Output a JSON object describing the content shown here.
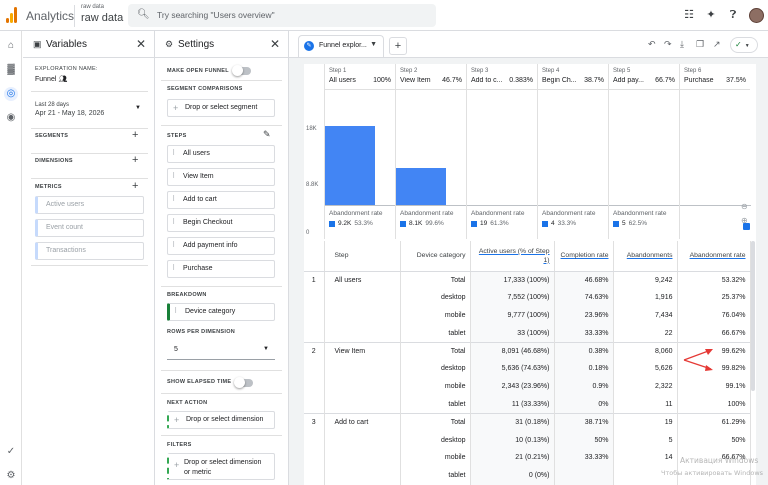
{
  "app": {
    "title": "Analytics",
    "property_small": "raw data",
    "property_big": "raw data",
    "search_placeholder": "Try searching \"Users overview\""
  },
  "variables_panel": {
    "title": "Variables",
    "exploration_name_label": "EXPLORATION NAME:",
    "exploration_name": "Funnel",
    "date_label": "Last 28 days",
    "date_range": "Apr 21 - May 18, 2026",
    "segments_label": "SEGMENTS",
    "dimensions_label": "DIMENSIONS",
    "metrics_label": "METRICS",
    "metrics": [
      "Active users",
      "Event count",
      "Transactions"
    ]
  },
  "settings_panel": {
    "title": "Settings",
    "make_open_funnel_label": "MAKE OPEN FUNNEL",
    "segment_comparisons_label": "SEGMENT COMPARISONS",
    "segment_drop": "Drop or select segment",
    "steps_label": "STEPS",
    "steps": [
      "All users",
      "View Item",
      "Add to cart",
      "Begin Checkout",
      "Add payment info",
      "Purchase"
    ],
    "breakdown_label": "BREAKDOWN",
    "breakdown_value": "Device category",
    "rows_per_dimension_label": "ROWS PER DIMENSION",
    "rows_per_dimension_value": "5",
    "show_elapsed_time_label": "SHOW ELAPSED TIME",
    "next_action_label": "NEXT ACTION",
    "next_action_drop": "Drop or select dimension",
    "filters_label": "FILTERS",
    "filters_drop_line1": "Drop or select dimension",
    "filters_drop_line2": "or metric"
  },
  "main": {
    "tab_label": "Funnel explor...",
    "status_icon": "check-circle-icon"
  },
  "chart_data": {
    "type": "bar",
    "categories": [
      "All users",
      "View Item",
      "Add to c...",
      "Begin Ch...",
      "Add pay...",
      "Purchase"
    ],
    "step_numbers": [
      "Step 1",
      "Step 2",
      "Step 3",
      "Step 4",
      "Step 5",
      "Step 6"
    ],
    "step_percents": [
      "100%",
      "46.7%",
      "0.383%",
      "38.7%",
      "66.7%",
      "37.5%"
    ],
    "values": [
      17333,
      8091,
      31,
      12,
      8,
      3
    ],
    "y_ticks": [
      "18K",
      "8.8K",
      "0"
    ],
    "ylim": [
      0,
      18000
    ],
    "abandonment_label": "Abandonment rate",
    "abandonment_counts": [
      "9.2K",
      "8.1K",
      "19",
      "4",
      "5",
      ""
    ],
    "abandonment_pcts": [
      "53.3%",
      "99.6%",
      "61.3%",
      "33.3%",
      "62.5%",
      ""
    ],
    "bar_color": "#4285f4"
  },
  "table": {
    "headers": [
      "Step",
      "Device category",
      "Active users (% of Step 1)",
      "Completion rate",
      "Abandonments",
      "Abandonment rate"
    ],
    "rows": [
      {
        "n": "1",
        "step": "All users",
        "dev": "Total",
        "au": "17,333 (100%)",
        "cr": "46.68%",
        "ab": "9,242",
        "ar": "53.32%"
      },
      {
        "n": "",
        "step": "",
        "dev": "desktop",
        "au": "7,552 (100%)",
        "cr": "74.63%",
        "ab": "1,916",
        "ar": "25.37%"
      },
      {
        "n": "",
        "step": "",
        "dev": "mobile",
        "au": "9,777 (100%)",
        "cr": "23.96%",
        "ab": "7,434",
        "ar": "76.04%"
      },
      {
        "n": "",
        "step": "",
        "dev": "tablet",
        "au": "33 (100%)",
        "cr": "33.33%",
        "ab": "22",
        "ar": "66.67%"
      },
      {
        "n": "2",
        "step": "View Item",
        "dev": "Total",
        "au": "8,091 (46.68%)",
        "cr": "0.38%",
        "ab": "8,060",
        "ar": "99.62%"
      },
      {
        "n": "",
        "step": "",
        "dev": "desktop",
        "au": "5,636 (74.63%)",
        "cr": "0.18%",
        "ab": "5,626",
        "ar": "99.82%"
      },
      {
        "n": "",
        "step": "",
        "dev": "mobile",
        "au": "2,343 (23.96%)",
        "cr": "0.9%",
        "ab": "2,322",
        "ar": "99.1%"
      },
      {
        "n": "",
        "step": "",
        "dev": "tablet",
        "au": "11 (33.33%)",
        "cr": "0%",
        "ab": "11",
        "ar": "100%"
      },
      {
        "n": "3",
        "step": "Add to cart",
        "dev": "Total",
        "au": "31 (0.18%)",
        "cr": "38.71%",
        "ab": "19",
        "ar": "61.29%"
      },
      {
        "n": "",
        "step": "",
        "dev": "desktop",
        "au": "10 (0.13%)",
        "cr": "50%",
        "ab": "5",
        "ar": "50%"
      },
      {
        "n": "",
        "step": "",
        "dev": "mobile",
        "au": "21 (0.21%)",
        "cr": "33.33%",
        "ab": "14",
        "ar": "66.67%"
      },
      {
        "n": "",
        "step": "",
        "dev": "tablet",
        "au": "0 (0%)",
        "cr": "",
        "ab": "",
        "ar": ""
      }
    ]
  },
  "watermark": {
    "line1": "Активация Windows",
    "line2": "Чтобы активировать Windows"
  }
}
